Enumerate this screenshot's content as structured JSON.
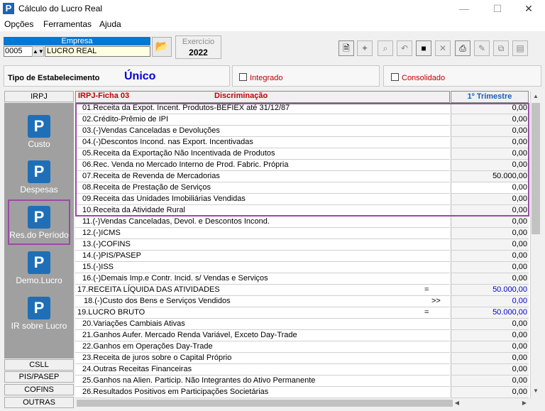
{
  "window": {
    "title": "Cálculo do Lucro Real",
    "icon_letter": "P",
    "minimize": "—",
    "maximize": "☐",
    "close": "✕"
  },
  "menu": [
    {
      "label": "Opções"
    },
    {
      "label": "Ferramentas"
    },
    {
      "label": "Ajuda"
    }
  ],
  "empresa": {
    "header": "Empresa",
    "code": "0005",
    "name": "LUCRO REAL"
  },
  "exercicio": {
    "label": "Exercício",
    "value": "2022"
  },
  "estabelecimento": {
    "label": "Tipo de Estabelecimento",
    "value": "Único",
    "integrado": "Integrado",
    "consolidado": "Consolidado"
  },
  "sidebar": {
    "top": "IRPJ",
    "items": [
      {
        "label": "Custo",
        "icon": "P"
      },
      {
        "label": "Despesas",
        "icon": "P"
      },
      {
        "label": "Res.do Período",
        "icon": "P"
      },
      {
        "label": "Demo.Lucro",
        "icon": "P"
      },
      {
        "label": "IR sobre Lucro",
        "icon": "P"
      }
    ],
    "bottom": [
      {
        "label": "CSLL"
      },
      {
        "label": "PIS/PASEP"
      },
      {
        "label": "COFINS"
      },
      {
        "label": "OUTRAS"
      }
    ]
  },
  "table": {
    "ficha": "IRPJ-Ficha  03",
    "discriminacao": "Discriminação",
    "column": "1º Trimestre",
    "rows": [
      {
        "label": "01.Receita da Expot. Incent. Produtos-BEFIEX até 31/12/87",
        "value": "0,00",
        "indent": 1,
        "sym": ""
      },
      {
        "label": "02.Crédito-Prêmio de IPI",
        "value": "0,00",
        "indent": 1,
        "sym": ""
      },
      {
        "label": "03.(-)Vendas Canceladas e Devoluções",
        "value": "0,00",
        "indent": 1,
        "sym": ""
      },
      {
        "label": "04.(-)Descontos Incond. nas Export. Incentivadas",
        "value": "0,00",
        "indent": 1,
        "sym": ""
      },
      {
        "label": "05.Receita da Exportação Não Incentivada de Produtos",
        "value": "0,00",
        "indent": 1,
        "sym": ""
      },
      {
        "label": "06.Rec. Venda no Mercado Interno de Prod. Fabric. Própria",
        "value": "0,00",
        "indent": 1,
        "sym": ""
      },
      {
        "label": "07.Receita de Revenda de Mercadorias",
        "value": "50.000,00",
        "indent": 1,
        "sym": ""
      },
      {
        "label": "08.Receita de Prestação de Serviços",
        "value": "0,00",
        "indent": 1,
        "sym": "",
        "white": true
      },
      {
        "label": "09.Receita das Unidades Imobiliárias Vendidas",
        "value": "0,00",
        "indent": 1,
        "sym": ""
      },
      {
        "label": "10.Receita da Atividade Rural",
        "value": "0,00",
        "indent": 1,
        "sym": ""
      },
      {
        "label": "11.(-)Vendas Canceladas, Devol. e Descontos Incond.",
        "value": "0,00",
        "indent": 1,
        "sym": ""
      },
      {
        "label": "12.(-)ICMS",
        "value": "0,00",
        "indent": 1,
        "sym": ""
      },
      {
        "label": "13.(-)COFINS",
        "value": "0,00",
        "indent": 1,
        "sym": ""
      },
      {
        "label": "14.(-)PIS/PASEP",
        "value": "0,00",
        "indent": 1,
        "sym": ""
      },
      {
        "label": "15.(-)ISS",
        "value": "0,00",
        "indent": 1,
        "sym": ""
      },
      {
        "label": "16.(-)Demais Imp.e Contr. Incid. s/ Vendas e Serviços",
        "value": "0,00",
        "indent": 1,
        "sym": ""
      },
      {
        "label": "17.RECEITA LÍQUIDA DAS ATIVIDADES",
        "value": "50.000,00",
        "indent": 0,
        "sym": "=",
        "blue": true
      },
      {
        "label": "18.(-)Custo dos Bens e Serviços Vendidos",
        "value": "0,00",
        "indent": 2,
        "sym": ">>",
        "blue": true
      },
      {
        "label": "19.LUCRO BRUTO",
        "value": "50.000,00",
        "indent": 0,
        "sym": "=",
        "blue": true
      },
      {
        "label": "20.Variações Cambiais Ativas",
        "value": "0,00",
        "indent": 1,
        "sym": ""
      },
      {
        "label": "21.Ganhos Aufer. Mercado Renda Variável, Exceto Day-Trade",
        "value": "0,00",
        "indent": 1,
        "sym": ""
      },
      {
        "label": "22.Ganhos em Operações Day-Trade",
        "value": "0,00",
        "indent": 1,
        "sym": ""
      },
      {
        "label": "23.Receita de juros sobre o Capital Próprio",
        "value": "0,00",
        "indent": 1,
        "sym": ""
      },
      {
        "label": "24.Outras Receitas Financeiras",
        "value": "0,00",
        "indent": 1,
        "sym": ""
      },
      {
        "label": "25.Ganhos na Alien. Particip. Não Integrantes do Ativo Permanente",
        "value": "0,00",
        "indent": 1,
        "sym": ""
      },
      {
        "label": "26.Resultados Positivos em Participações Societárias",
        "value": "0,00",
        "indent": 1,
        "sym": ""
      }
    ]
  },
  "toolbar": [
    {
      "icon": "document-icon",
      "glyph": "🗎",
      "enabled": true
    },
    {
      "icon": "gear-icon",
      "glyph": "✦",
      "enabled": false
    },
    {
      "icon": "search-icon",
      "glyph": "⌕",
      "enabled": false
    },
    {
      "icon": "undo-icon",
      "glyph": "↶",
      "enabled": false
    },
    {
      "icon": "save-icon",
      "glyph": "■",
      "enabled": true
    },
    {
      "icon": "delete-icon",
      "glyph": "✕",
      "enabled": false
    },
    {
      "icon": "print-icon",
      "glyph": "⎙",
      "enabled": true
    },
    {
      "icon": "tools-icon",
      "glyph": "✎",
      "enabled": false
    },
    {
      "icon": "copy-icon",
      "glyph": "⧉",
      "enabled": false
    },
    {
      "icon": "export-icon",
      "glyph": "▤",
      "enabled": false
    }
  ]
}
